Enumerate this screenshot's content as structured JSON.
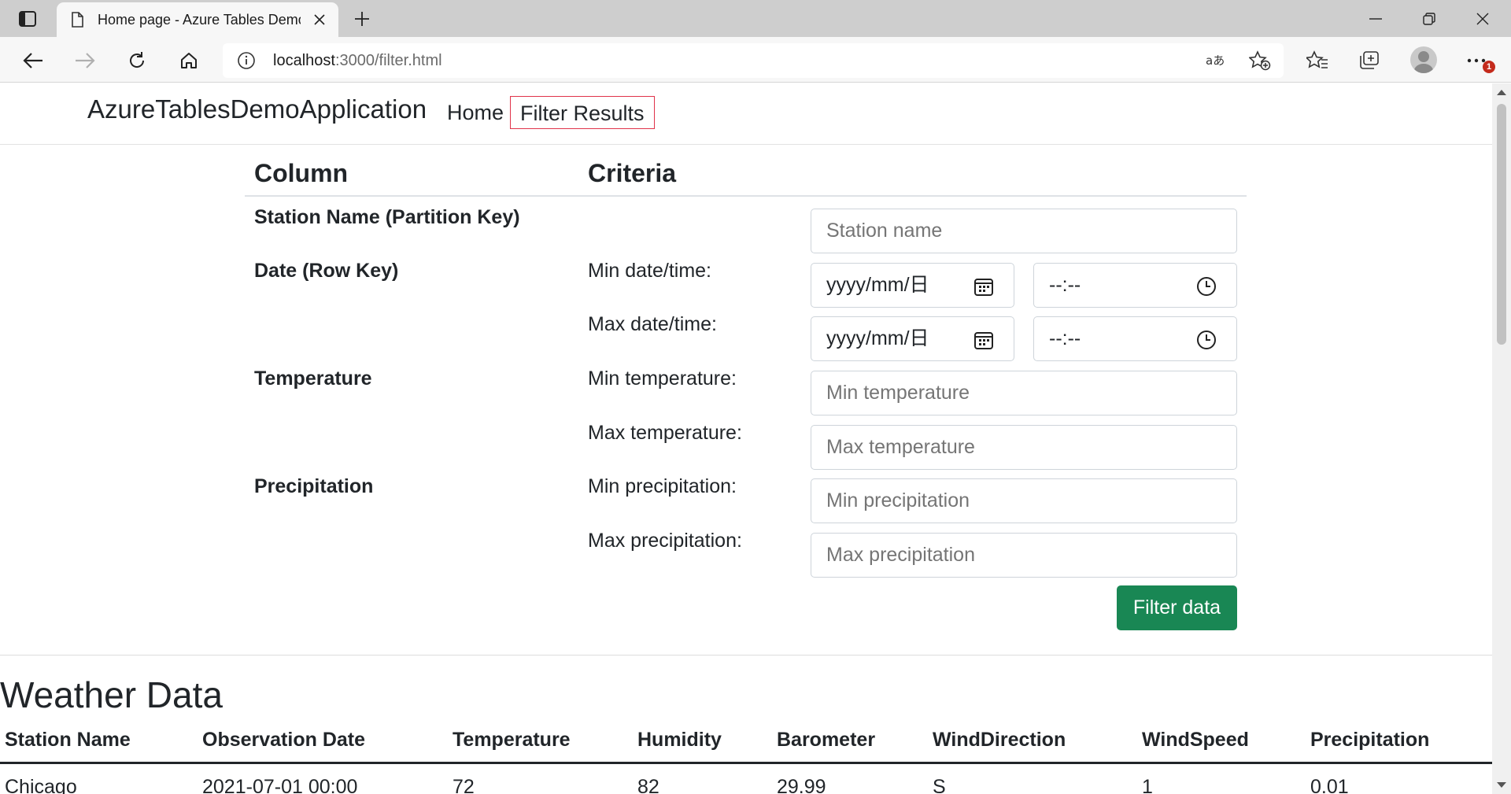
{
  "browser": {
    "tab_title": "Home page - Azure Tables Demo Application",
    "url_host": "localhost",
    "url_path": ":3000/filter.html",
    "notification_count": "1"
  },
  "nav": {
    "brand": "AzureTablesDemoApplication",
    "home": "Home",
    "filter_results": "Filter Results"
  },
  "filter": {
    "header_column": "Column",
    "header_criteria": "Criteria",
    "station_label": "Station Name (Partition Key)",
    "station_placeholder": "Station name",
    "date_label": "Date (Row Key)",
    "min_datetime_label": "Min date/time:",
    "max_datetime_label": "Max date/time:",
    "date_placeholder": "yyyy/mm/日",
    "time_placeholder": "--:--",
    "temperature_label": "Temperature",
    "min_temperature_label": "Min temperature:",
    "min_temperature_placeholder": "Min temperature",
    "max_temperature_label": "Max temperature:",
    "max_temperature_placeholder": "Max temperature",
    "precipitation_label": "Precipitation",
    "min_precipitation_label": "Min precipitation:",
    "min_precipitation_placeholder": "Min precipitation",
    "max_precipitation_label": "Max precipitation:",
    "max_precipitation_placeholder": "Max precipitation",
    "submit_label": "Filter data"
  },
  "weather": {
    "title": "Weather Data",
    "columns": [
      "Station Name",
      "Observation Date",
      "Temperature",
      "Humidity",
      "Barometer",
      "WindDirection",
      "WindSpeed",
      "Precipitation"
    ],
    "rows": [
      [
        "Chicago",
        "2021-07-01 00:00",
        "72",
        "82",
        "29.99",
        "S",
        "1",
        "0.01"
      ]
    ]
  }
}
